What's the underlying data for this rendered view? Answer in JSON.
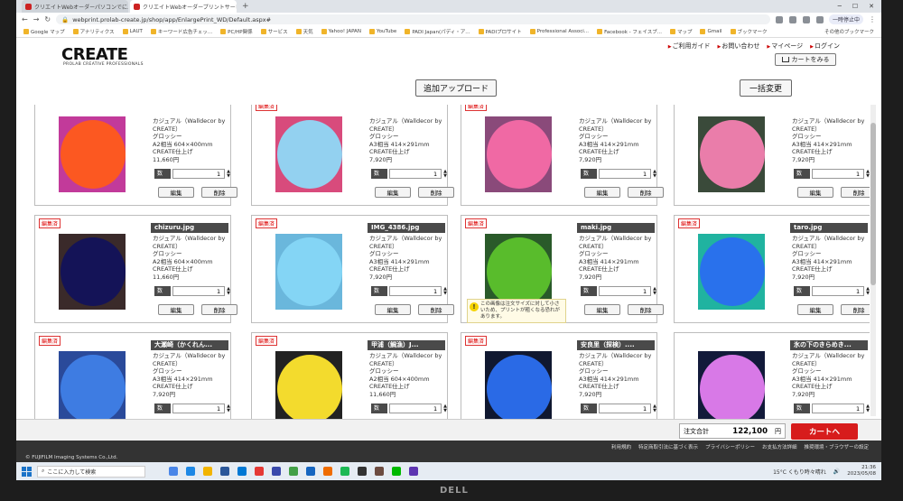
{
  "browser": {
    "tabs": [
      {
        "label": "クリエイトWebオーダーパソコンでに..."
      },
      {
        "label": "クリエイトWebオーダープリントサービス"
      }
    ],
    "url": "webprint.prolab-create.jp/shop/app/EnlargePrint_WD/Default.aspx#",
    "profile_label": "一時停止中",
    "bookmarks": [
      "Google マップ",
      "アナリティクス",
      "LAUT",
      "キーワード広告チェッ...",
      "PC/HP関係",
      "サービス",
      "天気",
      "Yahoo! JAPAN",
      "YouTube",
      "PADI Japan(パディ・ア...",
      "PADIプロサイト",
      "Professional Associ...",
      "Facebook - フェイスブ...",
      "マップ",
      "Gmail",
      "ブックマーク"
    ],
    "bookmarks_other": "その他のブックマーク"
  },
  "site": {
    "logo": "CREATE",
    "logo_sub": "PROLAB CREATIVE PROFESSIONALS",
    "links": [
      "ご利用ガイド",
      "お問い合わせ",
      "マイページ",
      "ログイン"
    ],
    "cart_button": "カートをみる"
  },
  "toolbar": {
    "add_upload": "追加アップロード",
    "bulk_change": "一括変更"
  },
  "labels": {
    "edited": "編集済",
    "qty": "数量",
    "edit": "編集",
    "delete": "削除"
  },
  "items": [
    {
      "name": "",
      "edited": false,
      "l1": "カジュアル（Walldecor by",
      "l2": "CREATE）",
      "l3": "グロッシー",
      "size": "A2相当 604×400mm",
      "finish": "CREATE仕上げ",
      "price": "11,660円",
      "qty": "1",
      "color": "#ff5a1a",
      "bg": "#c23a9a"
    },
    {
      "name": "",
      "edited": true,
      "l1": "カジュアル（Walldecor by",
      "l2": "CREATE）",
      "l3": "グロッシー",
      "size": "A3相当 414×291mm",
      "finish": "CREATE仕上げ",
      "price": "7,920円",
      "qty": "1",
      "color": "#8fd8f7",
      "bg": "#d84b7c"
    },
    {
      "name": "",
      "edited": true,
      "l1": "カジュアル（Walldecor by",
      "l2": "CREATE）",
      "l3": "グロッシー",
      "size": "A3相当 414×291mm",
      "finish": "CREATE仕上げ",
      "price": "7,920円",
      "qty": "1",
      "color": "#f56aa6",
      "bg": "#8a4a7a"
    },
    {
      "name": "",
      "edited": false,
      "l1": "カジュアル（Walldecor by",
      "l2": "CREATE）",
      "l3": "グロッシー",
      "size": "A3相当 414×291mm",
      "finish": "CREATE仕上げ",
      "price": "7,920円",
      "qty": "1",
      "color": "#f37fb0",
      "bg": "#3a4a3a"
    },
    {
      "name": "chizuru.jpg",
      "edited": true,
      "l1": "カジュアル（Walldecor by",
      "l2": "CREATE）",
      "l3": "グロッシー",
      "size": "A2相当 604×400mm",
      "finish": "CREATE仕上げ",
      "price": "11,660円",
      "qty": "1",
      "color": "#12125a",
      "bg": "#3a2a2a"
    },
    {
      "name": "IMG_4386.jpg",
      "edited": true,
      "l1": "カジュアル（Walldecor by",
      "l2": "CREATE）",
      "l3": "グロッシー",
      "size": "A3相当 414×291mm",
      "finish": "CREATE仕上げ",
      "price": "7,920円",
      "qty": "1",
      "color": "#86d6f5",
      "bg": "#6ab7dc"
    },
    {
      "name": "maki.jpg",
      "edited": true,
      "l1": "カジュアル（Walldecor by",
      "l2": "CREATE）",
      "l3": "グロッシー",
      "size": "A3相当 414×291mm",
      "finish": "CREATE仕上げ",
      "price": "7,920円",
      "qty": "1",
      "color": "#5cc22c",
      "bg": "#2a5a2a",
      "warning": "この画像は注文サイズに対して小さいため、プリントが粗くなる恐れがあります。"
    },
    {
      "name": "taro.jpg",
      "edited": true,
      "l1": "カジュアル（Walldecor by",
      "l2": "CREATE）",
      "l3": "グロッシー",
      "size": "A3相当 414×291mm",
      "finish": "CREATE仕上げ",
      "price": "7,920円",
      "qty": "1",
      "color": "#2a6ef0",
      "bg": "#20b3a0"
    },
    {
      "name": "大瀬崎（かくれん...",
      "edited": true,
      "l1": "カジュアル（Walldecor by",
      "l2": "CREATE）",
      "l3": "グロッシー",
      "size": "A3相当 414×291mm",
      "finish": "CREATE仕上げ",
      "price": "7,920円",
      "qty": "1",
      "color": "#3f7ee6",
      "bg": "#2a4a9a"
    },
    {
      "name": "甲浦（鯛漁）J...",
      "edited": true,
      "l1": "カジュアル（Walldecor by",
      "l2": "CREATE）",
      "l3": "グロッシー",
      "size": "A2相当 604×400mm",
      "finish": "CREATE仕上げ",
      "price": "11,660円",
      "qty": "1",
      "color": "#ffe62e",
      "bg": "#222222"
    },
    {
      "name": "安良里（探検）....",
      "edited": true,
      "l1": "カジュアル（Walldecor by",
      "l2": "CREATE）",
      "l3": "グロッシー",
      "size": "A3相当 414×291mm",
      "finish": "CREATE仕上げ",
      "price": "7,920円",
      "qty": "1",
      "color": "#2c6ff0",
      "bg": "#101830"
    },
    {
      "name": "氷の下のきらめき...",
      "edited": false,
      "l1": "カジュアル（Walldecor by",
      "l2": "CREATE）",
      "l3": "グロッシー",
      "size": "A3相当 414×291mm",
      "finish": "CREATE仕上げ",
      "price": "7,920円",
      "qty": "1",
      "color": "#e47ef0",
      "bg": "#121a3a"
    }
  ],
  "cart": {
    "total_label": "注文合計",
    "total_value": "122,100",
    "currency": "円",
    "checkout": "カートへ"
  },
  "footer": {
    "copyright": "© FUJIFILM Imaging Systems Co.,Ltd.",
    "links": [
      "利用規約",
      "特定商取引法に基づく表示",
      "プライバシーポリシー",
      "お支払方法詳細",
      "推奨環境・ブラウザーの設定"
    ]
  },
  "taskbar": {
    "search": "ここに入力して検索",
    "weather": "15°C くもり時々晴れ",
    "time": "21:36",
    "date": "2023/05/08"
  },
  "monitor_brand": "DELL"
}
